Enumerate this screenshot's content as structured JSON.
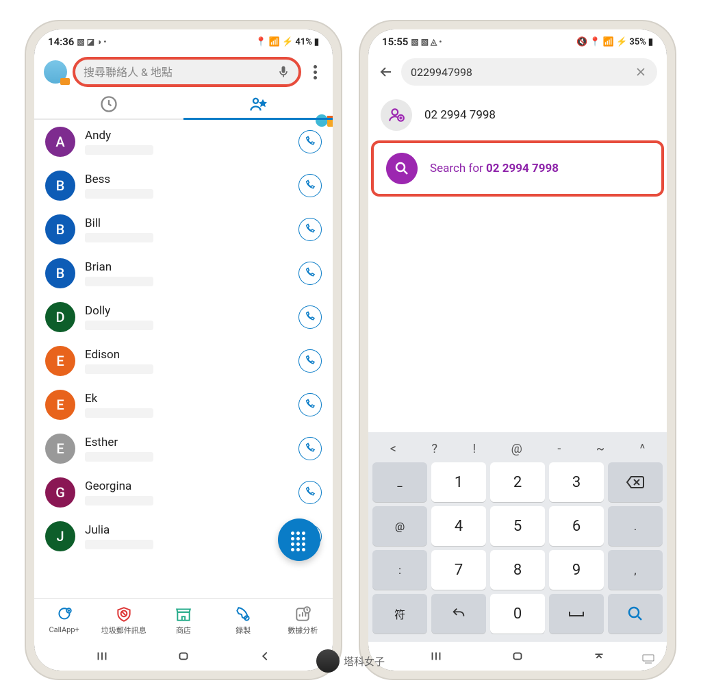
{
  "left": {
    "status": {
      "time": "14:36",
      "battery": "41%"
    },
    "search": {
      "placeholder": "搜尋聯絡人 & 地點"
    },
    "contacts": [
      {
        "letter": "A",
        "name": "Andy",
        "color": "#7e2b8f"
      },
      {
        "letter": "B",
        "name": "Bess",
        "color": "#0d5cb6"
      },
      {
        "letter": "B",
        "name": "Bill",
        "color": "#0d5cb6"
      },
      {
        "letter": "B",
        "name": "Brian",
        "color": "#0d5cb6"
      },
      {
        "letter": "D",
        "name": "Dolly",
        "color": "#0d5e2a"
      },
      {
        "letter": "E",
        "name": "Edison",
        "color": "#e8631c"
      },
      {
        "letter": "E",
        "name": "Ek",
        "color": "#e8631c"
      },
      {
        "letter": "E",
        "name": "Esther",
        "color": "#999999"
      },
      {
        "letter": "G",
        "name": "Georgina",
        "color": "#8a1754"
      },
      {
        "letter": "J",
        "name": "Julia",
        "color": "#0d5e2a"
      }
    ],
    "nav": [
      {
        "label": "CallApp+"
      },
      {
        "label": "垃圾郵件訊息"
      },
      {
        "label": "商店"
      },
      {
        "label": "錄製"
      },
      {
        "label": "數據分析"
      }
    ]
  },
  "right": {
    "status": {
      "time": "15:55",
      "battery": "35%"
    },
    "search": {
      "value": "0229947998"
    },
    "result_number": "02 2994 7998",
    "search_for_prefix": "Search for ",
    "search_for_number": "02 2994 7998",
    "keyboard": {
      "suggest": [
        "<",
        "?",
        "!",
        "@",
        "-",
        "~",
        "^"
      ],
      "row1": [
        "_",
        "1",
        "2",
        "3"
      ],
      "row2": [
        "@",
        "4",
        "5",
        "6",
        "."
      ],
      "row3": [
        ":",
        "7",
        "8",
        "9",
        ","
      ],
      "row4": [
        "符",
        "↶",
        "0",
        "⌣"
      ]
    }
  },
  "watermark": "塔科女子"
}
